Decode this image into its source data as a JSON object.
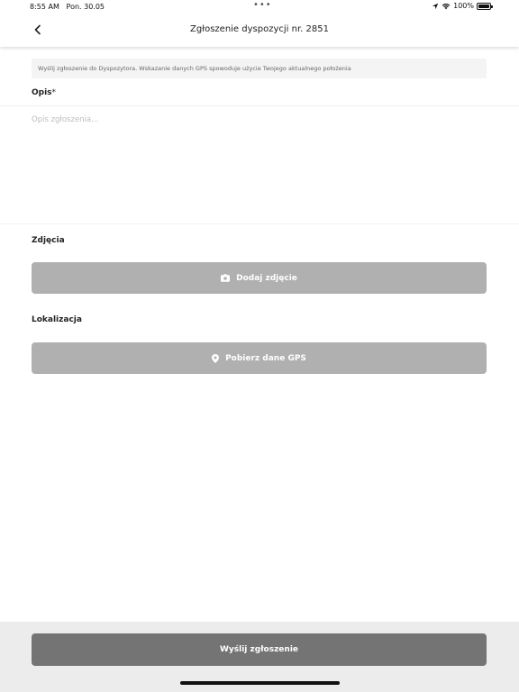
{
  "status_bar": {
    "time": "8:55 AM",
    "date": "Pon. 30.05",
    "dots": "•••",
    "battery": "100%",
    "icons": [
      "location-arrow-icon",
      "wifi-icon",
      "battery-icon"
    ]
  },
  "nav": {
    "back_icon": "chevron-left-icon",
    "title": "Zgłoszenie dyspozycji nr. 2851"
  },
  "info_banner": "Wyślij zgłoszenie do Dyspozytora. Wskazanie danych GPS spowoduje użycie Twojego aktualnego położenia",
  "description": {
    "label": "Opis",
    "required_marker": "*",
    "placeholder": "Opis zgłoszenia...",
    "value": ""
  },
  "photos": {
    "label": "Zdjęcia",
    "button_label": "Dodaj zdjęcie",
    "button_icon": "camera-icon"
  },
  "location": {
    "label": "Lokalizacja",
    "button_label": "Pobierz dane GPS",
    "button_icon": "map-pin-icon"
  },
  "footer": {
    "submit_label": "Wyślij zgłoszenie"
  },
  "colors": {
    "button_gray": "#b0b0b0",
    "submit_gray": "#747474",
    "footer_bg": "#ececec",
    "banner_bg": "#f4f4f4"
  }
}
